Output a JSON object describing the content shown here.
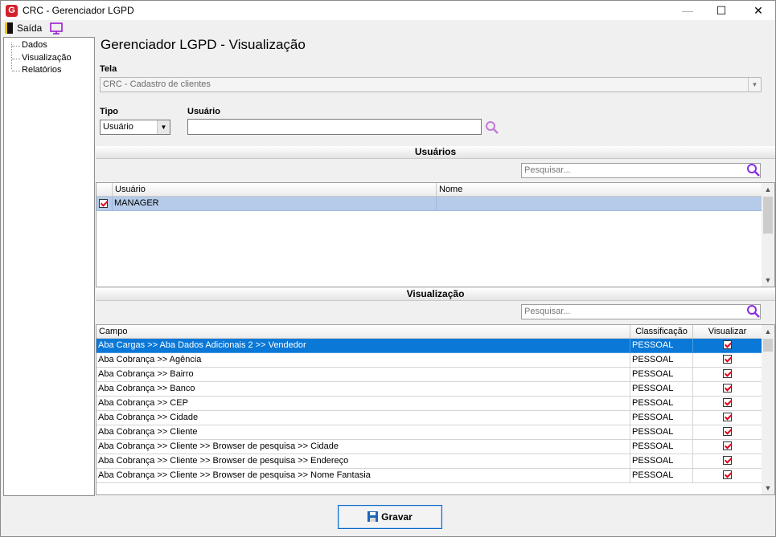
{
  "window": {
    "title": "CRC - Gerenciador LGPD",
    "logo_letter": "G"
  },
  "toolbar": {
    "exit_label": "Saída"
  },
  "sidebar": {
    "items": [
      {
        "label": "Dados"
      },
      {
        "label": "Visualização"
      },
      {
        "label": "Relatórios"
      }
    ]
  },
  "main": {
    "title": "Gerenciador LGPD - Visualização",
    "tela_label": "Tela",
    "tela_value": "CRC - Cadastro de clientes",
    "tipo_label": "Tipo",
    "tipo_value": "Usuário",
    "usuario_label": "Usuário",
    "usuario_value": ""
  },
  "users_section": {
    "title": "Usuários",
    "search_placeholder": "Pesquisar...",
    "columns": [
      "Usuário",
      "Nome"
    ],
    "rows": [
      {
        "checked": true,
        "usuario": "MANAGER",
        "nome": ""
      }
    ]
  },
  "view_section": {
    "title": "Visualização",
    "search_placeholder": "Pesquisar...",
    "columns": [
      "Campo",
      "Classificação",
      "Visualizar"
    ],
    "rows": [
      {
        "campo": "Aba Cargas >> Aba Dados Adicionais 2 >> Vendedor",
        "classificacao": "PESSOAL",
        "visualizar": true
      },
      {
        "campo": "Aba Cobrança >> Agência",
        "classificacao": "PESSOAL",
        "visualizar": true
      },
      {
        "campo": "Aba Cobrança >> Bairro",
        "classificacao": "PESSOAL",
        "visualizar": true
      },
      {
        "campo": "Aba Cobrança >> Banco",
        "classificacao": "PESSOAL",
        "visualizar": true
      },
      {
        "campo": "Aba Cobrança >> CEP",
        "classificacao": "PESSOAL",
        "visualizar": true
      },
      {
        "campo": "Aba Cobrança >> Cidade",
        "classificacao": "PESSOAL",
        "visualizar": true
      },
      {
        "campo": "Aba Cobrança >> Cliente",
        "classificacao": "PESSOAL",
        "visualizar": true
      },
      {
        "campo": "Aba Cobrança >> Cliente >> Browser de pesquisa >> Cidade",
        "classificacao": "PESSOAL",
        "visualizar": true
      },
      {
        "campo": "Aba Cobrança >> Cliente >> Browser de pesquisa >> Endereço",
        "classificacao": "PESSOAL",
        "visualizar": true
      },
      {
        "campo": "Aba Cobrança >> Cliente >> Browser de pesquisa >> Nome Fantasia",
        "classificacao": "PESSOAL",
        "visualizar": true
      }
    ]
  },
  "footer": {
    "save_label": "Gravar"
  },
  "colors": {
    "selection": "#0a78d7",
    "user_selection": "#b6cbe9",
    "search_icon": "#8a2be2",
    "check_mark": "#e0001b"
  },
  "icons": {
    "logo": "app-logo-icon",
    "exit": "exit-door-icon",
    "monitor": "monitor-icon",
    "search": "search-icon",
    "save": "floppy-disk-icon"
  }
}
